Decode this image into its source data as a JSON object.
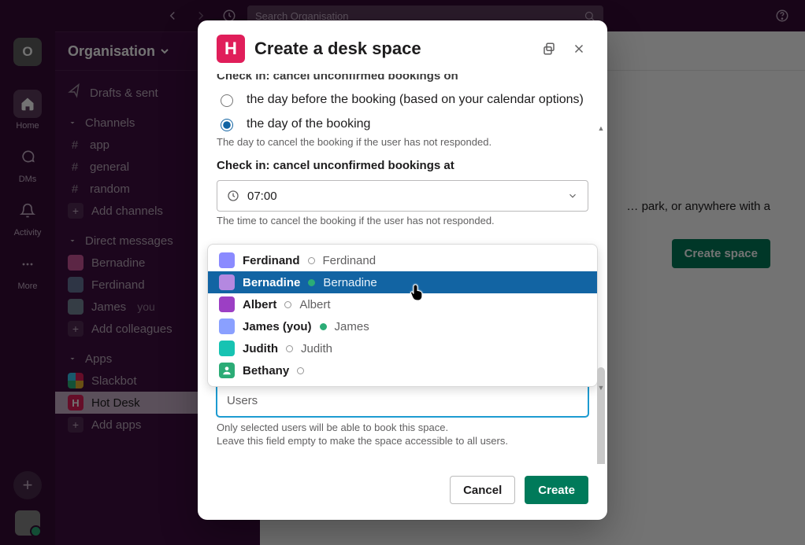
{
  "search_placeholder": "Search Organisation",
  "workspace": {
    "name": "Organisation",
    "initial": "O"
  },
  "rail": [
    {
      "label": "Home",
      "active": true
    },
    {
      "label": "DMs"
    },
    {
      "label": "Activity"
    },
    {
      "label": "More"
    }
  ],
  "sidebar": {
    "drafts": "Drafts & sent",
    "channels_section": "Channels",
    "channels": [
      "app",
      "general",
      "random"
    ],
    "add_channels": "Add channels",
    "dms_section": "Direct messages",
    "dms": [
      {
        "name": "Bernadine",
        "online": false
      },
      {
        "name": "Ferdinand",
        "online": false
      },
      {
        "name": "James",
        "you_suffix": "you",
        "online": true
      }
    ],
    "add_colleagues": "Add colleagues",
    "apps_section": "Apps",
    "apps": [
      {
        "name": "Slackbot",
        "type": "slackbot"
      },
      {
        "name": "Hot Desk",
        "type": "hotdesk",
        "active": true
      }
    ],
    "add_apps": "Add apps"
  },
  "main": {
    "peek_text": "… park, or anywhere with a",
    "cta": "Create space"
  },
  "modal": {
    "title": "Create a desk space",
    "truncated_label": "Check in: cancel unconfirmed bookings on",
    "radio1": "the day before the booking (based on your calendar options)",
    "radio2": "the day of the booking",
    "helper1": "The day to cancel the booking if the user has not responded.",
    "time_label": "Check in: cancel unconfirmed bookings at",
    "time_value": "07:00",
    "helper_time": "The time to cancel the booking if the user has not responded.",
    "user_menu": [
      {
        "name": "Ferdinand",
        "display": "Ferdinand",
        "online": false,
        "avatarBg": "#8a8aff"
      },
      {
        "name": "Bernadine",
        "display": "Bernadine",
        "online": true,
        "selected": true,
        "avatarBg": "#b488e0"
      },
      {
        "name": "Albert",
        "display": "Albert",
        "online": false,
        "avatarBg": "#9c3fc4"
      },
      {
        "name": "James (you)",
        "display": "James",
        "online": true,
        "avatarBg": "#8aa0ff"
      },
      {
        "name": "Judith",
        "display": "Judith",
        "online": false,
        "avatarBg": "#17c3b2"
      },
      {
        "name": "Bethany",
        "display": "",
        "online": false,
        "avatarBg": "#2bac76",
        "noDisplay": true
      }
    ],
    "users_placeholder": "Users",
    "helper_users1": "Only selected users will be able to book this space.",
    "helper_users2": "Leave this field empty to make the space accessible to all users.",
    "cancel": "Cancel",
    "submit": "Create"
  }
}
